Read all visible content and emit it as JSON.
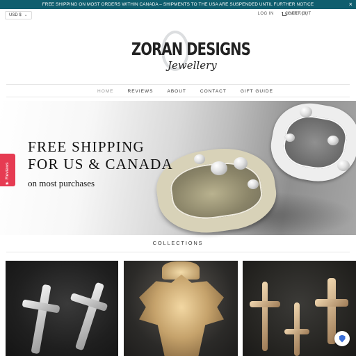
{
  "announcement": {
    "text": "FREE SHIPPING ON MOST ORDERS WITHIN CANADA – SHIPMENTS TO THE USA ARE SUSPENDED UNTIL FURTHER NOTICE",
    "close_icon": "×"
  },
  "utility": {
    "currency": "USD $",
    "currency_chevron": "⌄",
    "login": "LOG IN",
    "cart": "CART (0)",
    "checkout": "CHECKOUT"
  },
  "logo": {
    "title": "ZORAN DESIGNS",
    "script": "Jewellery"
  },
  "nav": {
    "items": [
      {
        "label": "HOME",
        "active": true
      },
      {
        "label": "REVIEWS"
      },
      {
        "label": "ABOUT"
      },
      {
        "label": "CONTACT"
      },
      {
        "label": "GIFT GUIDE"
      }
    ]
  },
  "hero": {
    "title_line1": "FREE SHIPPING",
    "title_line2": "FOR US & CANADA",
    "subtitle": "on most purchases"
  },
  "reviews_tab": {
    "label": "Reviews",
    "star": "★"
  },
  "collections": {
    "heading": "COLLECTIONS"
  },
  "colors": {
    "announcement_bg": "#0f5e6e",
    "reviews_tab": "#e63b52",
    "text": "#333333"
  }
}
